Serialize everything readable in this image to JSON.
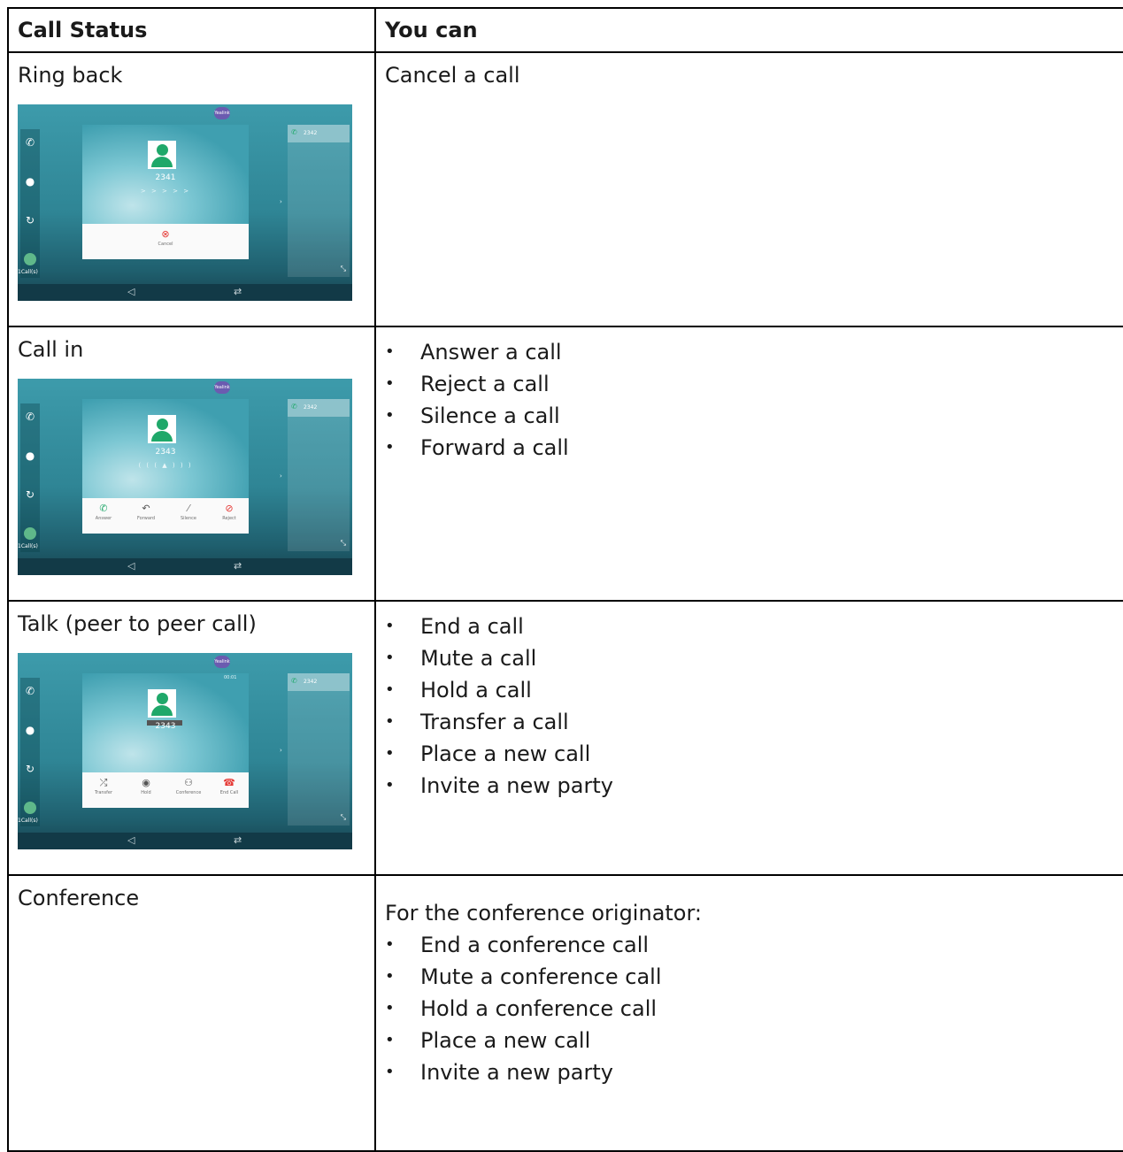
{
  "table": {
    "headers": {
      "status": "Call Status",
      "actions": "You can"
    },
    "rows": [
      {
        "status": "Ring back",
        "screen": {
          "name_small": "Cancel",
          "number": "2341",
          "dots": "> > > > >",
          "line": "2342",
          "badge": "Yealink",
          "calls": "1Call(s)"
        },
        "action_text": "Cancel a call"
      },
      {
        "status": "Call in",
        "screen": {
          "number": "2343",
          "dots": "( ( ( ▲ ) ) )",
          "line": "2342",
          "badge": "Yealink",
          "calls": "1Call(s)",
          "buttons": [
            "Answer",
            "Forward",
            "Silence",
            "Reject"
          ]
        },
        "actions": [
          "Answer a call",
          "Reject a call",
          "Silence a call",
          "Forward a call"
        ]
      },
      {
        "status": "Talk (peer to peer call)",
        "screen": {
          "number": "2343",
          "line": "2342",
          "badge": "Yealink",
          "calls": "1Call(s)",
          "timer": "00:01",
          "buttons": [
            "Transfer",
            "Hold",
            "Conference",
            "End Call"
          ]
        },
        "actions": [
          "End a call",
          "Mute a call",
          "Hold a call",
          "Transfer a call",
          "Place a new call",
          "Invite a new party"
        ]
      },
      {
        "status": "Conference",
        "intro": "For the conference originator:",
        "actions": [
          "End a conference call",
          "Mute a conference call",
          "Hold a conference call",
          "Place a new call",
          "Invite a new party"
        ]
      }
    ]
  }
}
